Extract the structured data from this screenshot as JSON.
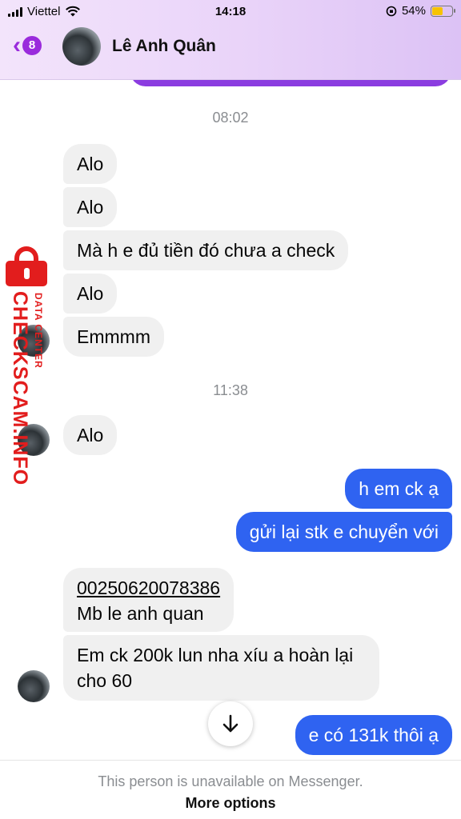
{
  "status_bar": {
    "carrier": "Viettel",
    "time": "14:18",
    "battery": "54%"
  },
  "header": {
    "back_count": "8",
    "contact_name": "Lê Anh Quân"
  },
  "conversation": {
    "stamps": [
      "08:02",
      "11:38"
    ],
    "incoming": [
      "Alo",
      "Alo",
      "Mà h e đủ tiền đó chưa a check",
      "Alo",
      "Emmmm",
      "Alo",
      "Em ck 200k lun nha xíu a hoàn lại cho 60"
    ],
    "account_message": {
      "account_number": "00250620078386",
      "account_name": "Mb le anh quan"
    },
    "outgoing": [
      "h em ck ạ",
      "gửi lại stk e chuyển với",
      "e có 131k thôi ạ"
    ]
  },
  "watermark": {
    "main": "CHECKSCAM.INFO",
    "sub": "DATA CENTER"
  },
  "footer": {
    "note": "This person is unavailable on Messenger.",
    "more_options": "More options"
  },
  "colors": {
    "outgoing_bubble": "#2f63f1",
    "incoming_bubble": "#f0f0f0",
    "accent": "#9a2bdc",
    "watermark": "#e21d1d"
  },
  "icons": [
    "back-chevron-icon",
    "wifi-icon",
    "battery-icon",
    "scroll-down-icon",
    "lock-icon"
  ]
}
